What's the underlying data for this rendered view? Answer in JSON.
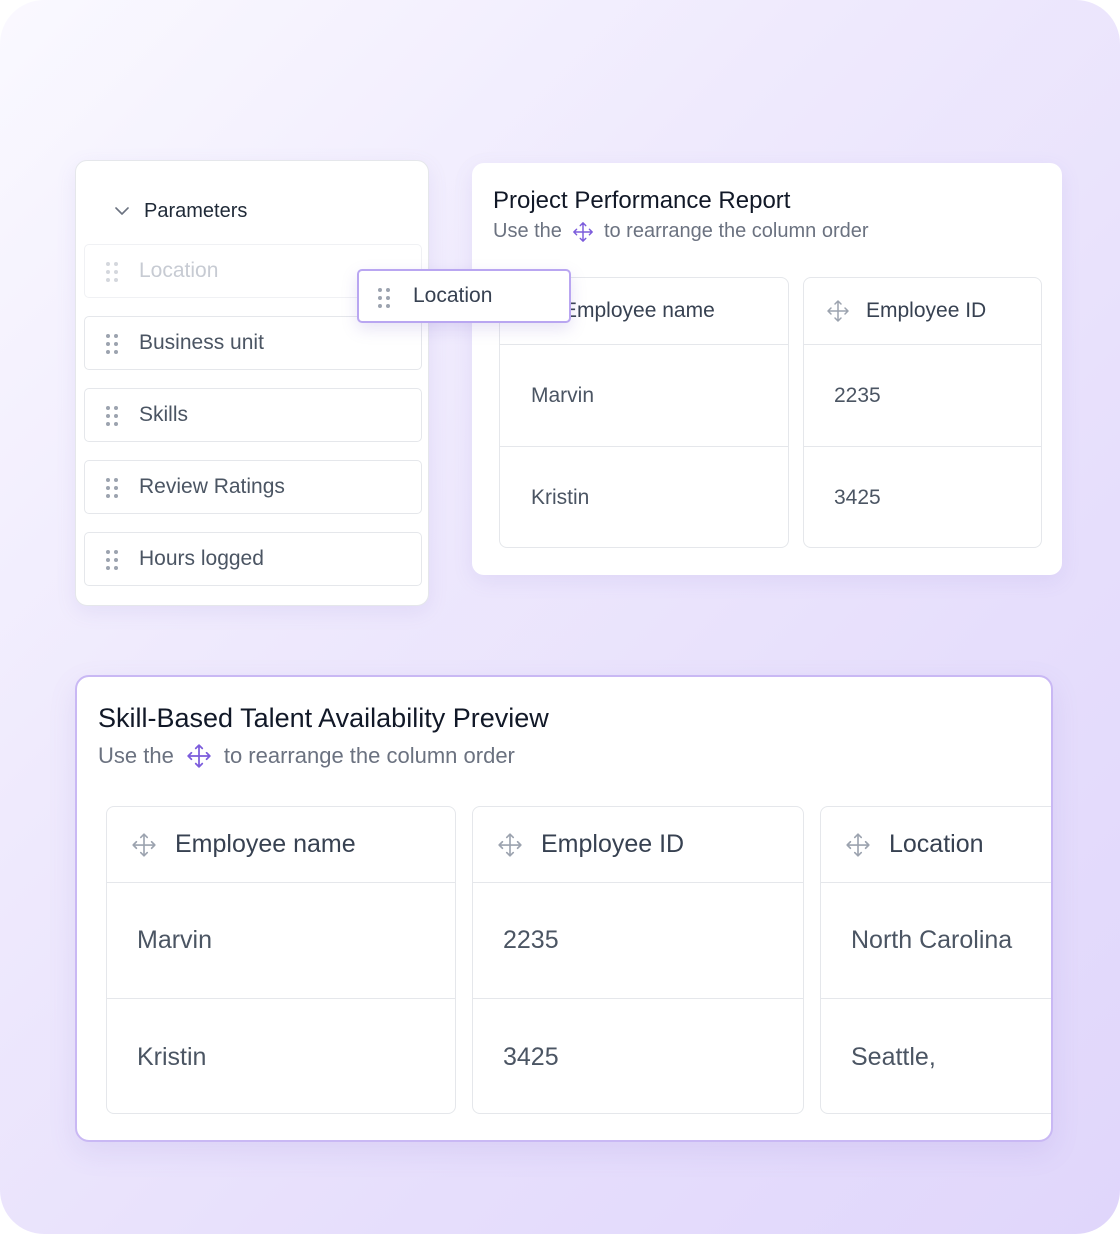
{
  "parameters": {
    "title": "Parameters",
    "items": [
      {
        "label": "Location",
        "state": "placeholder"
      },
      {
        "label": "Business unit"
      },
      {
        "label": "Skills"
      },
      {
        "label": "Review Ratings"
      },
      {
        "label": "Hours logged"
      }
    ],
    "dragging": {
      "label": "Location"
    }
  },
  "report": {
    "title": "Project Performance Report",
    "hint_before": "Use the",
    "hint_after": "to rearrange the column order",
    "columns": [
      {
        "header": "Employee name",
        "rows": [
          "Marvin",
          "Kristin"
        ]
      },
      {
        "header": "Employee ID",
        "rows": [
          "2235",
          "3425"
        ]
      }
    ]
  },
  "preview": {
    "title": "Skill-Based Talent Availability Preview",
    "hint_before": "Use the",
    "hint_after": "to rearrange the column order",
    "columns": [
      {
        "header": "Employee name",
        "rows": [
          "Marvin",
          "Kristin"
        ]
      },
      {
        "header": "Employee ID",
        "rows": [
          "2235",
          "3425"
        ]
      },
      {
        "header": "Location",
        "rows": [
          "North Carolina",
          "Seattle,"
        ]
      }
    ]
  },
  "colors": {
    "accent": "#7c5cdc",
    "move_icon_gray": "#9ca3af",
    "highlight_border": "#b9a6f1"
  },
  "icons": {
    "move": "move-arrows-icon",
    "grip": "drag-grip-icon",
    "chevron": "chevron-down-icon"
  }
}
